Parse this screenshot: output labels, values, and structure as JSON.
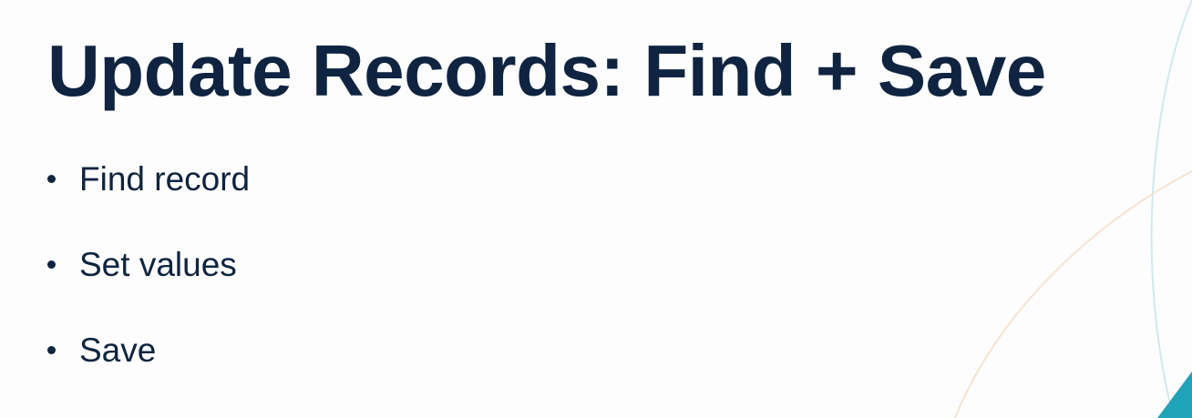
{
  "slide": {
    "title": "Update Records: Find + Save",
    "bullets": [
      {
        "text": "Find record"
      },
      {
        "text": "Set values"
      },
      {
        "text": "Save"
      }
    ]
  },
  "colors": {
    "text": "#0e2440",
    "background": "#fdfdfd",
    "accent_teal": "#1fa3b8",
    "arc_teal_light": "#cfe9ee",
    "arc_peach_light": "#f6e3cf"
  }
}
